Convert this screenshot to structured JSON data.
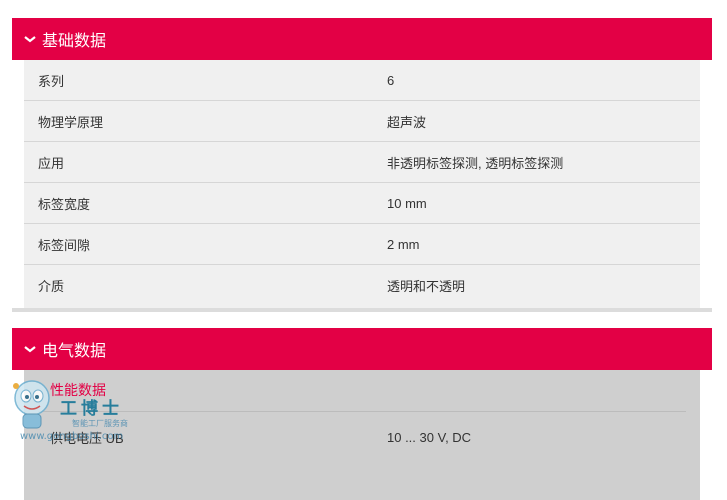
{
  "colors": {
    "accent": "#e30045",
    "table_bg": "#f0f0f0",
    "sub_bg": "#cfcfcf"
  },
  "sections": [
    {
      "title": "基础数据",
      "icon": "chevron-down-icon",
      "rows": [
        {
          "label": "系列",
          "value": "6"
        },
        {
          "label": "物理学原理",
          "value": "超声波"
        },
        {
          "label": "应用",
          "value": "非透明标签探测, 透明标签探测"
        },
        {
          "label": "标签宽度",
          "value": "10 mm"
        },
        {
          "label": "标签间隙",
          "value": "2 mm"
        },
        {
          "label": "介质",
          "value": "透明和不透明"
        }
      ]
    },
    {
      "title": "电气数据",
      "icon": "chevron-down-icon",
      "subsection": "性能数据",
      "rows": [
        {
          "label": "供电电压 UB",
          "value": "10 ... 30 V, DC"
        }
      ]
    }
  ],
  "watermark": {
    "brand": "工博士",
    "tagline": "智能工厂服务商",
    "url": "www.gongboshi.com"
  }
}
